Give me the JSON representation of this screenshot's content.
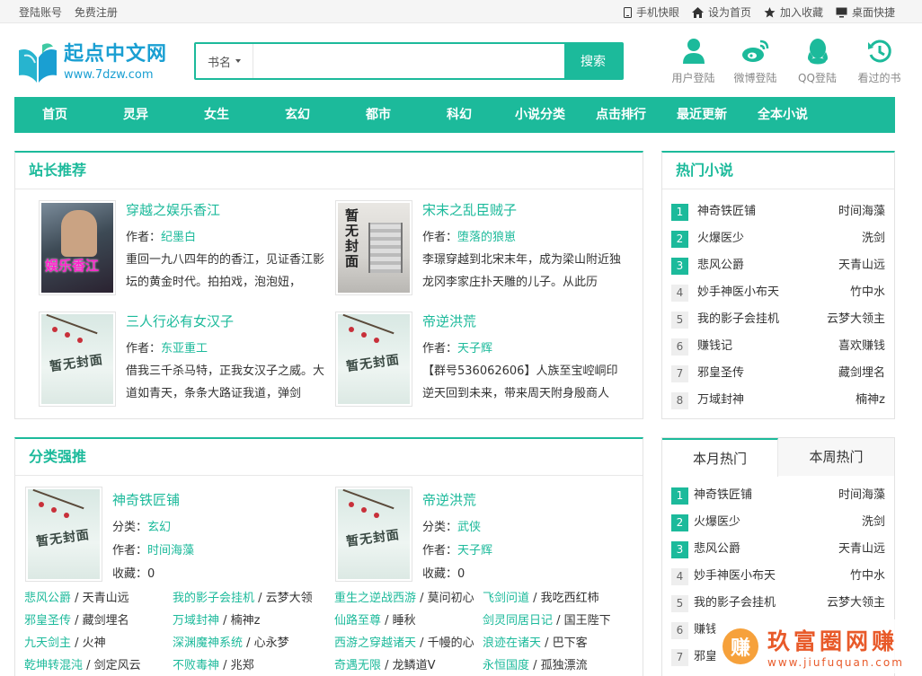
{
  "topbar": {
    "login": "登陆账号",
    "register": "免费注册",
    "right": [
      {
        "label": "手机快眼",
        "icon": "mobile-icon"
      },
      {
        "label": "设为首页",
        "icon": "home-icon"
      },
      {
        "label": "加入收藏",
        "icon": "star-icon"
      },
      {
        "label": "桌面快捷",
        "icon": "desktop-icon"
      }
    ]
  },
  "logo": {
    "name": "起点中文网",
    "url": "www.7dzw.com"
  },
  "search": {
    "select": "书名",
    "placeholder": "",
    "button": "搜索"
  },
  "header_icons": [
    {
      "label": "用户登陆",
      "icon": "user-icon"
    },
    {
      "label": "微博登陆",
      "icon": "weibo-icon"
    },
    {
      "label": "QQ登陆",
      "icon": "qq-icon"
    },
    {
      "label": "看过的书",
      "icon": "history-icon"
    }
  ],
  "nav": [
    "首页",
    "灵异",
    "女生",
    "玄幻",
    "都市",
    "科幻",
    "小说分类",
    "点击排行",
    "最近更新",
    "全本小说"
  ],
  "recommend": {
    "title": "站长推荐",
    "author_label": "作者：",
    "items": [
      {
        "title": "穿越之娱乐香江",
        "author": "纪墨白",
        "desc": "重回一九八四年的的香江，见证香江影坛的黄金时代。拍拍戏，泡泡妞，",
        "cover": "娱乐香江"
      },
      {
        "title": "宋末之乱臣贼子",
        "author": "堕落的狼崽",
        "desc": "李璟穿越到北宋末年，成为梁山附近独龙冈李家庄扑天雕的儿子。从此历",
        "cover": "暂无封面"
      },
      {
        "title": "三人行必有女汉子",
        "author": "东亚重工",
        "desc": "借我三千杀马特，正我女汉子之威。大道如青天，条条大路证我道，弹剑",
        "cover": "暂无封面"
      },
      {
        "title": "帝逆洪荒",
        "author": "天子辉",
        "desc": "【群号536062606】人族至宝崆峒印逆天回到未来，带来周天附身殷商人",
        "cover": "暂无封面"
      }
    ]
  },
  "hot": {
    "title": "热门小说",
    "items": [
      {
        "num": "1",
        "name": "神奇铁匠铺",
        "author": "时间海藻"
      },
      {
        "num": "2",
        "name": "火爆医少",
        "author": "洗剑"
      },
      {
        "num": "3",
        "name": "悲风公爵",
        "author": "天青山远"
      },
      {
        "num": "4",
        "name": "妙手神医小布天",
        "author": "竹中水"
      },
      {
        "num": "5",
        "name": "我的影子会挂机",
        "author": "云梦大领主"
      },
      {
        "num": "6",
        "name": "赚钱记",
        "author": "喜欢赚钱"
      },
      {
        "num": "7",
        "name": "邪皇圣传",
        "author": "藏剑埋名"
      },
      {
        "num": "8",
        "name": "万域封神",
        "author": "楠神z"
      }
    ]
  },
  "category": {
    "title": "分类强推",
    "class_label": "分类：",
    "author_label": "作者：",
    "fav_label": "收藏：",
    "items": [
      {
        "title": "神奇铁匠铺",
        "class": "玄幻",
        "author": "时间海藻",
        "fav": "0",
        "cover": "暂无封面"
      },
      {
        "title": "帝逆洪荒",
        "class": "武侠",
        "author": "天子辉",
        "fav": "0",
        "cover": "暂无封面"
      }
    ],
    "links_left": [
      [
        {
          "n": "悲风公爵",
          "a": "天青山远"
        },
        {
          "n": "我的影子会挂机",
          "a": "云梦大领"
        }
      ],
      [
        {
          "n": "邪皇圣传",
          "a": "藏剑埋名"
        },
        {
          "n": "万域封神",
          "a": "楠神z"
        }
      ],
      [
        {
          "n": "九天剑主",
          "a": "火神"
        },
        {
          "n": "深渊魔神系统",
          "a": "心永梦"
        }
      ],
      [
        {
          "n": "乾坤转混沌",
          "a": "剑定风云"
        },
        {
          "n": "不败毒神",
          "a": "兆郑"
        }
      ]
    ],
    "links_right": [
      [
        {
          "n": "重生之逆战西游",
          "a": "莫问初心"
        },
        {
          "n": "飞剑问道",
          "a": "我吃西红柿"
        }
      ],
      [
        {
          "n": "仙路至尊",
          "a": "睡秋"
        },
        {
          "n": "剑灵同居日记",
          "a": "国王陛下"
        }
      ],
      [
        {
          "n": "西游之穿越诸天",
          "a": "千幔的心"
        },
        {
          "n": "浪迹在诸天",
          "a": "巴下客"
        }
      ],
      [
        {
          "n": "奇遇无限",
          "a": "龙鳞道V"
        },
        {
          "n": "永恒国度",
          "a": "孤独漂流"
        }
      ]
    ],
    "sep": " / "
  },
  "monthly": {
    "tabs": [
      "本月热门",
      "本周热门"
    ],
    "items": [
      {
        "num": "1",
        "name": "神奇铁匠铺",
        "author": "时间海藻"
      },
      {
        "num": "2",
        "name": "火爆医少",
        "author": "洗剑"
      },
      {
        "num": "3",
        "name": "悲风公爵",
        "author": "天青山远"
      },
      {
        "num": "4",
        "name": "妙手神医小布天",
        "author": "竹中水"
      },
      {
        "num": "5",
        "name": "我的影子会挂机",
        "author": "云梦大领主"
      },
      {
        "num": "6",
        "name": "赚钱",
        "author": ""
      },
      {
        "num": "7",
        "name": "邪皇",
        "author": ""
      }
    ]
  },
  "watermark": {
    "badge": "赚",
    "text": "玖富圈网赚",
    "url": "www.jiufuquan.com"
  }
}
